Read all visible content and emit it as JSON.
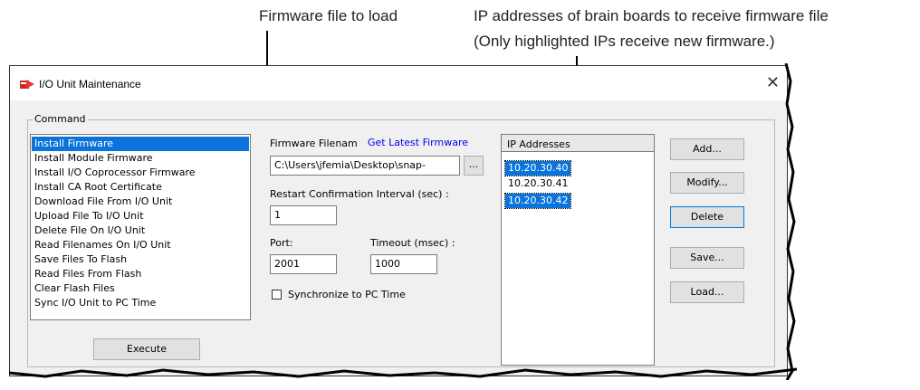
{
  "callouts": {
    "firmware_file": "Firmware file to load",
    "ip_line1": "IP addresses of brain boards to receive firmware file",
    "ip_line2": "(Only highlighted IPs receive new firmware.)"
  },
  "window": {
    "title": "I/O Unit Maintenance",
    "close_glyph": "✕"
  },
  "command": {
    "legend": "Command",
    "items": [
      "Install Firmware",
      "Install Module Firmware",
      "Install I/O Coprocessor Firmware",
      "Install CA Root Certificate",
      "Download File From I/O Unit",
      "Upload File To I/O Unit",
      "Delete File On I/O Unit",
      "Read Filenames On I/O Unit",
      "Save Files To Flash",
      "Read Files From Flash",
      "Clear Flash Files",
      "Sync I/O Unit to PC Time"
    ],
    "selected": "Install Firmware",
    "execute_label": "Execute"
  },
  "firmware": {
    "filename_label": "Firmware Filenam",
    "latest_link": "Get Latest Firmware",
    "filename_value": "C:\\Users\\jfemia\\Desktop\\snap-",
    "browse_label": "...",
    "restart_label": "Restart Confirmation Interval (sec) :",
    "restart_value": "1",
    "port_label": "Port:",
    "port_value": "2001",
    "timeout_label": "Timeout (msec) :",
    "timeout_value": "1000",
    "sync_label": "Synchronize to PC Time",
    "sync_checked": false
  },
  "ip": {
    "header": "IP Addresses",
    "addresses": [
      "10.20.30.40",
      "10.20.30.41",
      "10.20.30.42"
    ],
    "selected": [
      "10.20.30.40",
      "10.20.30.42"
    ]
  },
  "actions": {
    "add": "Add...",
    "modify": "Modify...",
    "delete": "Delete",
    "save": "Save...",
    "load": "Load..."
  },
  "colors": {
    "selection": "#0a74da",
    "link": "#0000ee"
  }
}
